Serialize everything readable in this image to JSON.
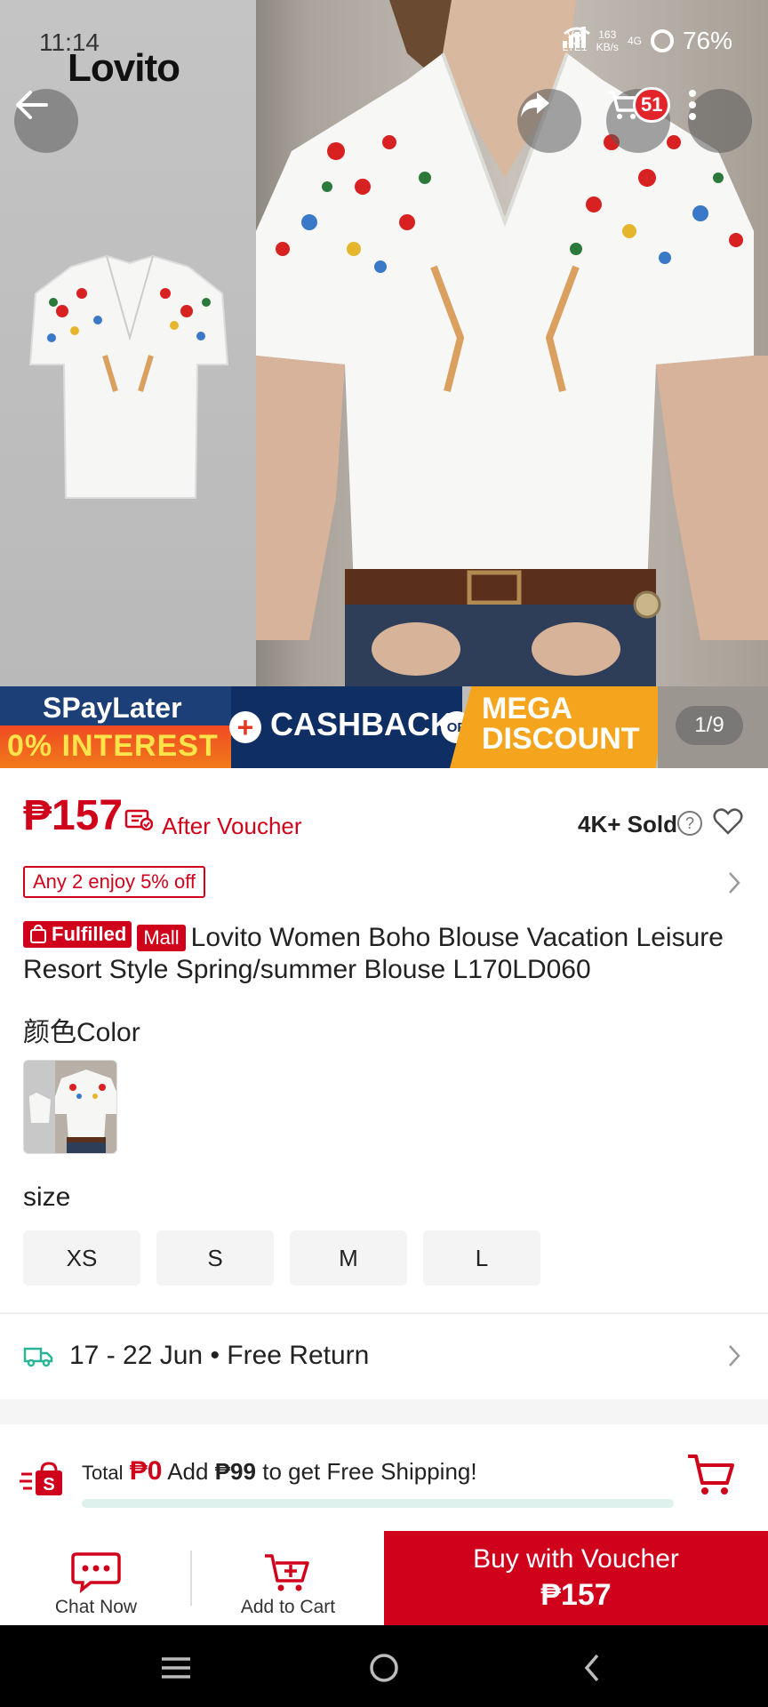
{
  "status_bar": {
    "time": "11:14",
    "net_line1": "Vo)",
    "net_line2": "LTE1",
    "speed_value": "163",
    "speed_unit": "KB/s",
    "network": "4G",
    "battery": "76%"
  },
  "hero": {
    "brand": "Lovito",
    "cart_count": "51",
    "image_counter": "1/9",
    "promo": {
      "paylater": "SPayLater",
      "interest": "0% INTEREST",
      "plus": "+",
      "cashback": "CASHBACK",
      "or": "OR",
      "mega_line1": "MEGA",
      "mega_line2": "DISCOUNT"
    }
  },
  "price": {
    "amount": "₱157",
    "after_voucher": "After Voucher",
    "sold": "4K+ Sold",
    "help": "?"
  },
  "promo_tag": "Any 2 enjoy 5% off",
  "title": {
    "badge_fulfilled": "Fulfilled",
    "badge_mall": "Mall",
    "text": "Lovito Women Boho Blouse Vacation Leisure Resort Style Spring/summer Blouse L170LD060"
  },
  "color": {
    "label": "颜色Color"
  },
  "size": {
    "label": "size",
    "options": [
      "XS",
      "S",
      "M",
      "L"
    ]
  },
  "delivery": {
    "text": "17 - 22 Jun • Free Return"
  },
  "shipping": {
    "total_label": "Total",
    "total_value": "₱0",
    "add_label": "Add",
    "add_value": "₱99",
    "suffix": "to get Free Shipping!",
    "progress": 0
  },
  "actions": {
    "chat": "Chat Now",
    "add_to_cart": "Add to Cart",
    "buy_line1": "Buy with Voucher",
    "buy_line2": "₱157"
  },
  "colors": {
    "accent": "#d0011b",
    "progress_track": "#dff1ec",
    "delivery_icon": "#2bb597"
  }
}
